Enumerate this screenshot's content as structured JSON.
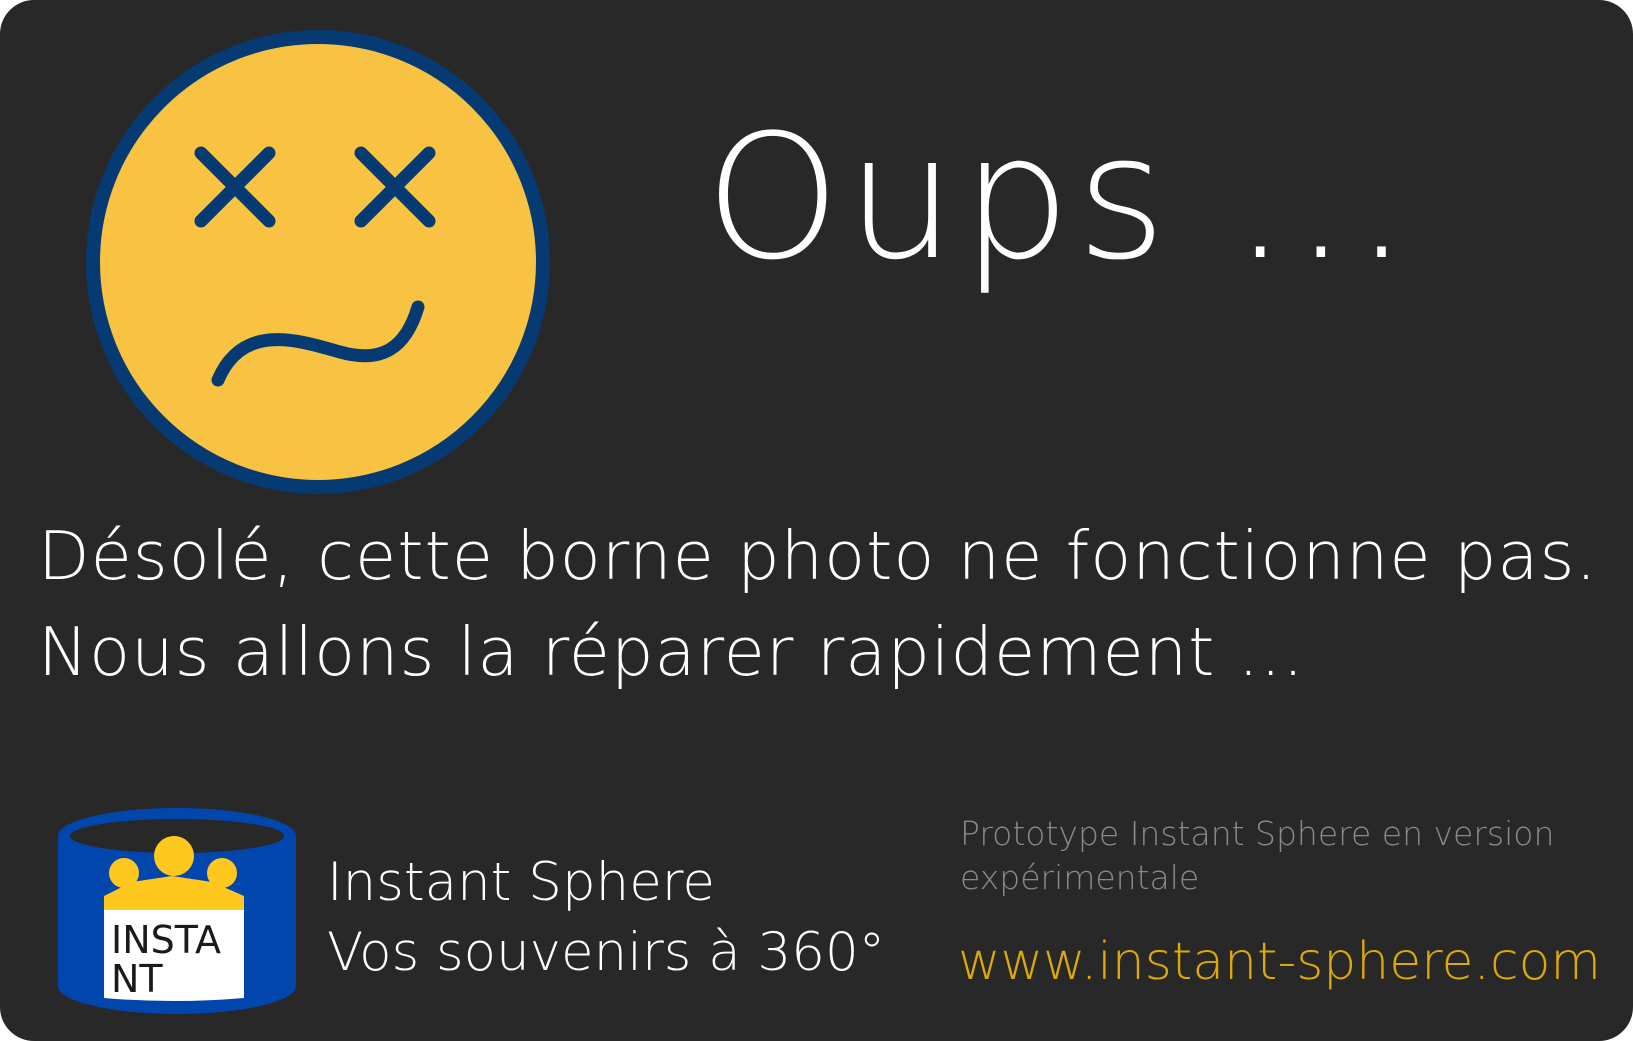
{
  "screen": {
    "title": "Oups ...",
    "message_line1": "Désolé, cette borne photo ne fonctionne pas.",
    "message_line2": "Nous allons la réparer rapidement ..."
  },
  "emoji": {
    "icon": "dizzy-face-icon",
    "face_color": "#f8c342",
    "outline_color": "#053a73"
  },
  "brand": {
    "logo_icon": "instant-sphere-logo",
    "logo_text_line1": "INSTA",
    "logo_text_line2": "NT",
    "name": "Instant Sphere",
    "tagline": "Vos souvenirs à 360°",
    "blue": "#0046ad",
    "yellow": "#ffc81e"
  },
  "footer": {
    "prototype_note": "Prototype Instant Sphere en version expérimentale",
    "website": "www.instant-sphere.com",
    "website_color": "#dca90a"
  }
}
